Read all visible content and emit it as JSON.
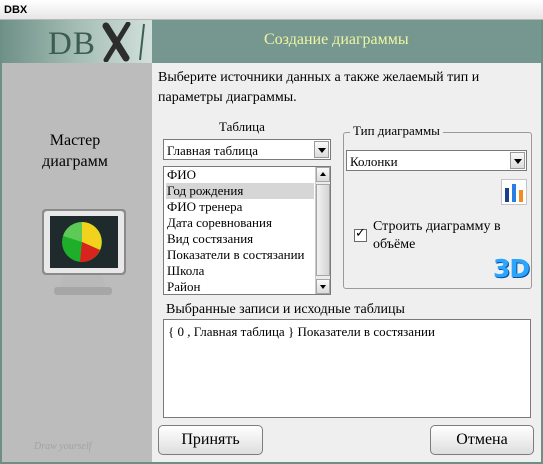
{
  "window": {
    "title": "DBX"
  },
  "banner": {
    "logo_text": "DB",
    "title": "Создание диаграммы"
  },
  "left_panel": {
    "master_label_line1": "Мастер",
    "master_label_line2": "диаграмм",
    "footer": "Draw yourself"
  },
  "instructions": "Выберите источники данных а также желаемый тип и параметры диаграммы.",
  "table_section": {
    "label": "Таблица",
    "selected_table": "Главная таблица",
    "fields": [
      "ФИО",
      "Год рождения",
      "ФИО тренера",
      "Дата соревнования",
      "Вид состязания",
      "Показатели в состязании",
      "Школа",
      "Район"
    ],
    "selected_field": "Год рождения"
  },
  "chart_type_section": {
    "legend": "Тип диаграммы",
    "selected_type": "Колонки",
    "checkbox_label": "Строить диаграмму в объёме",
    "checkbox_checked": true,
    "three_d_icon_text": "3D"
  },
  "selected_records": {
    "label": "Выбранные записи и исходные таблицы",
    "content": "{ 0 , Главная таблица } Показатели в состязании"
  },
  "buttons": {
    "accept": "Принять",
    "cancel": "Отмена"
  },
  "colors": {
    "banner": "#76978f",
    "banner_title": "#eef6a4",
    "left_panel": "#bcbcbc",
    "list_selection": "#d6d6d6",
    "three_d": "#2aa6ff"
  }
}
